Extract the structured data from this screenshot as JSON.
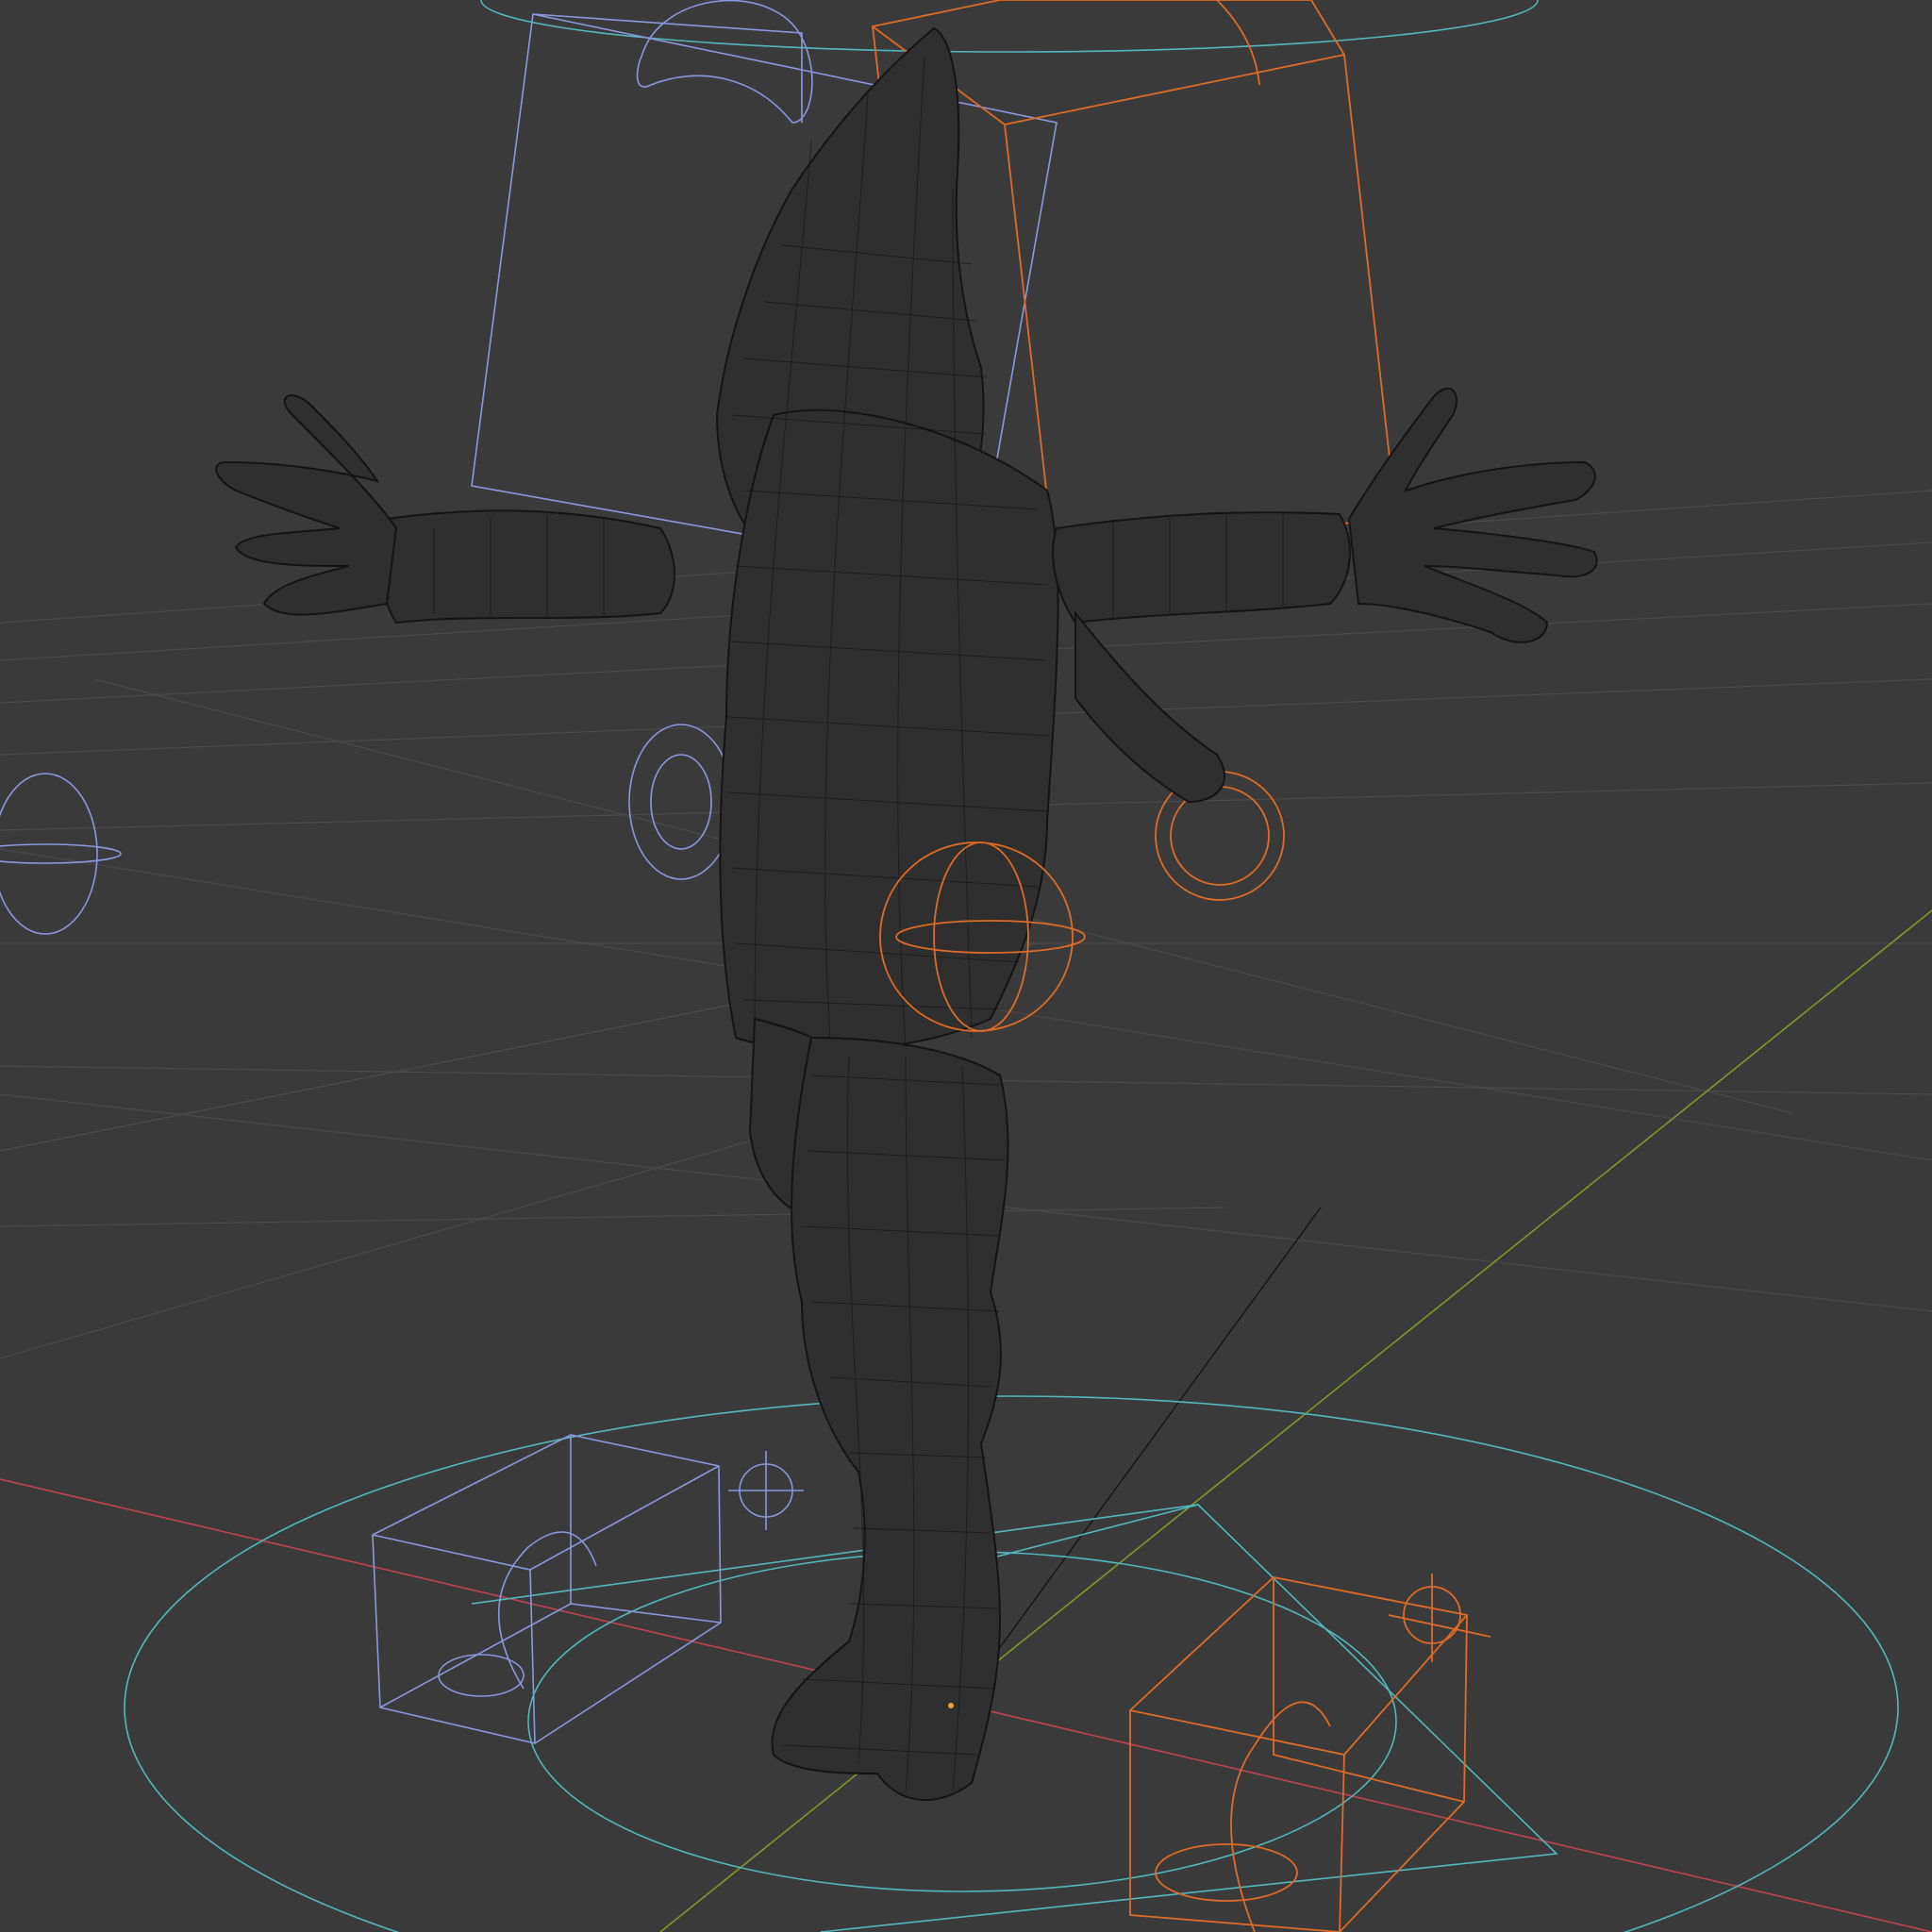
{
  "app": "3D viewport",
  "viewport": {
    "mode": "wireframe",
    "background_color": "#3a3a3a",
    "grid_color": "#484848",
    "axis_x_color": "#c1444f",
    "axis_y_color": "#7b9b2b"
  },
  "scene_objects": [
    {
      "name": "character-mesh",
      "kind": "mesh",
      "color": "#141414"
    },
    {
      "name": "left-ik-foot-control",
      "kind": "box",
      "color": "#8a98dd"
    },
    {
      "name": "right-ik-foot-control",
      "kind": "box",
      "color": "#de6b26"
    },
    {
      "name": "left-head-box-control",
      "kind": "box",
      "color": "#8a98dd"
    },
    {
      "name": "right-head-box-control",
      "kind": "box",
      "color": "#de6b26"
    },
    {
      "name": "root-circle-control",
      "kind": "circle",
      "color": "#52b8bd"
    },
    {
      "name": "hip-sphere-control",
      "kind": "sphere",
      "color": "#de6b26"
    },
    {
      "name": "left-hand-ring-control",
      "kind": "ring",
      "color": "#8a98dd"
    },
    {
      "name": "right-hand-ring-control",
      "kind": "ring",
      "color": "#de6b26"
    },
    {
      "name": "pole-target-sphere",
      "kind": "sphere",
      "color": "#8a98dd"
    },
    {
      "name": "left-pole-marker",
      "kind": "cross",
      "color": "#8a98dd"
    },
    {
      "name": "right-pole-marker",
      "kind": "cross",
      "color": "#de6b26"
    }
  ]
}
